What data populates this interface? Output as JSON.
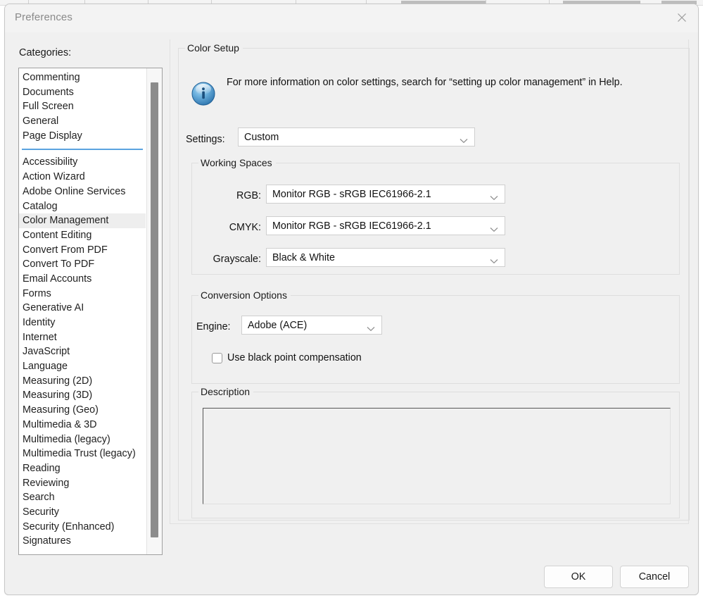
{
  "window": {
    "title": "Preferences",
    "close_icon": "close-icon"
  },
  "sidebar": {
    "label": "Categories:",
    "groups": [
      {
        "items": [
          "Commenting",
          "Documents",
          "Full Screen",
          "General",
          "Page Display"
        ]
      },
      {
        "items": [
          "Accessibility",
          "Action Wizard",
          "Adobe Online Services",
          "Catalog",
          "Color Management",
          "Content Editing",
          "Convert From PDF",
          "Convert To PDF",
          "Email Accounts",
          "Forms",
          "Generative AI",
          "Identity",
          "Internet",
          "JavaScript",
          "Language",
          "Measuring (2D)",
          "Measuring (3D)",
          "Measuring (Geo)",
          "Multimedia & 3D",
          "Multimedia (legacy)",
          "Multimedia Trust (legacy)",
          "Reading",
          "Reviewing",
          "Search",
          "Security",
          "Security (Enhanced)",
          "Signatures"
        ]
      }
    ],
    "selected": "Color Management"
  },
  "color_setup": {
    "legend": "Color Setup",
    "info_icon": "info-icon",
    "info_text": "For more information on color settings, search for “setting up color management” in Help.",
    "settings_label": "Settings:",
    "settings_value": "Custom"
  },
  "working_spaces": {
    "legend": "Working Spaces",
    "rgb_label": "RGB:",
    "rgb_value": "Monitor RGB - sRGB IEC61966-2.1",
    "cmyk_label": "CMYK:",
    "cmyk_value": "Monitor RGB - sRGB IEC61966-2.1",
    "grayscale_label": "Grayscale:",
    "grayscale_value": "Black & White"
  },
  "conversion_options": {
    "legend": "Conversion Options",
    "engine_label": "Engine:",
    "engine_value": "Adobe (ACE)",
    "black_point_label": "Use black point compensation",
    "black_point_checked": false
  },
  "description": {
    "legend": "Description",
    "text": ""
  },
  "footer": {
    "ok_label": "OK",
    "cancel_label": "Cancel"
  },
  "colors": {
    "dialog_bg": "#f0f0f0",
    "separator_blue": "#5ba3e0",
    "selection_gray": "#eeeeee",
    "info_blue": "#2e7cc4",
    "scrollbar_thumb": "#8c8c8c"
  }
}
